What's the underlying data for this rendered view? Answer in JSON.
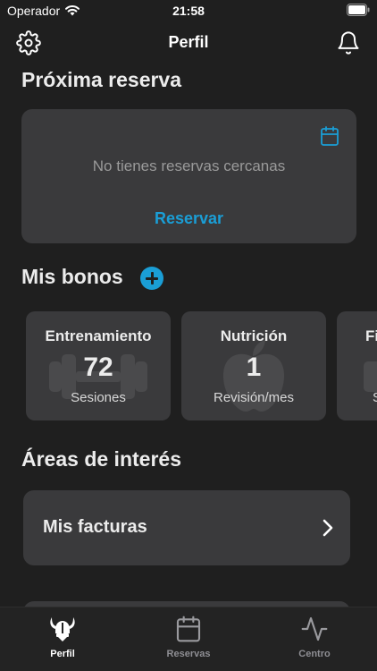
{
  "status_bar": {
    "carrier": "Operador",
    "time": "21:58"
  },
  "header": {
    "title": "Perfil"
  },
  "proxima_reserva": {
    "title": "Próxima reserva",
    "empty_text": "No tienes reservas cercanas",
    "action_label": "Reservar"
  },
  "bonos": {
    "title": "Mis bonos",
    "items": [
      {
        "title": "Entrenamiento",
        "value": "72",
        "unit": "Sesiones",
        "icon": "dumbbell-icon"
      },
      {
        "title": "Nutrición",
        "value": "1",
        "unit": "Revisión/mes",
        "icon": "apple-icon"
      },
      {
        "title": "Fi",
        "value": "",
        "unit": "S",
        "icon": "unknown-icon"
      }
    ]
  },
  "areas": {
    "title": "Áreas de interés",
    "items": [
      {
        "label": "Mis facturas"
      }
    ]
  },
  "tabs": [
    {
      "label": "Perfil",
      "icon": "viking-helmet-icon",
      "active": true
    },
    {
      "label": "Reservas",
      "icon": "calendar-icon",
      "active": false
    },
    {
      "label": "Centro",
      "icon": "activity-icon",
      "active": false
    }
  ],
  "colors": {
    "accent": "#1a9ed6",
    "background": "#1f1f1f",
    "card": "#3a3a3c"
  }
}
